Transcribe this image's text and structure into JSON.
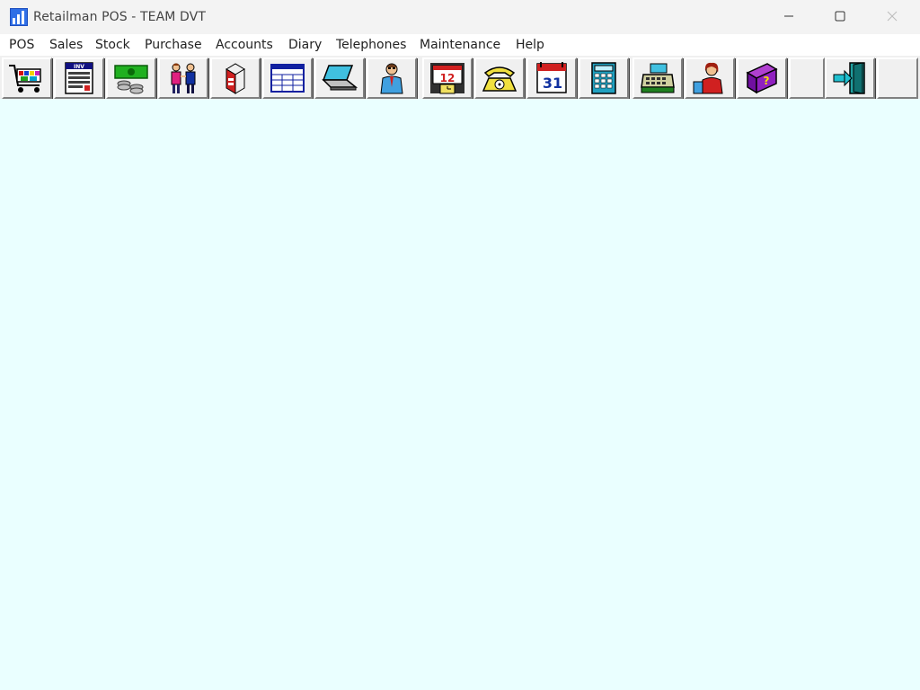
{
  "window": {
    "title": "Retailman POS - TEAM DVT",
    "controls": [
      "minimize-icon",
      "maximize-icon",
      "close-icon"
    ]
  },
  "menu": {
    "items": [
      {
        "label": "POS"
      },
      {
        "label": "Sales"
      },
      {
        "label": "Stock"
      },
      {
        "label": "Purchase"
      },
      {
        "label": "Accounts"
      },
      {
        "label": "Diary"
      },
      {
        "label": "Telephones"
      },
      {
        "label": "Maintenance"
      },
      {
        "label": "Help"
      }
    ]
  },
  "toolbar": {
    "buttons": [
      {
        "icon": "shopping-cart-icon"
      },
      {
        "icon": "invoice-icon",
        "text": "INV"
      },
      {
        "icon": "money-icon"
      },
      {
        "icon": "customers-icon"
      },
      {
        "icon": "stock-carton-icon"
      },
      {
        "icon": "form-grid-icon"
      },
      {
        "icon": "laptop-icon"
      },
      {
        "icon": "staff-icon"
      },
      {
        "icon": "clock-calendar-icon",
        "text": "12"
      },
      {
        "icon": "telephone-icon"
      },
      {
        "icon": "calendar-icon",
        "text": "31"
      },
      {
        "icon": "calculator-icon"
      },
      {
        "icon": "cash-register-icon"
      },
      {
        "icon": "user-support-icon"
      },
      {
        "icon": "help-book-icon",
        "text": "?"
      },
      {
        "icon": "blank"
      },
      {
        "icon": "exit-door-icon"
      },
      {
        "icon": "blank"
      }
    ]
  },
  "colors": {
    "client_background": "#eaffff",
    "titlebar": "#f3f3f3",
    "toolbar": "#f0f0f0"
  }
}
